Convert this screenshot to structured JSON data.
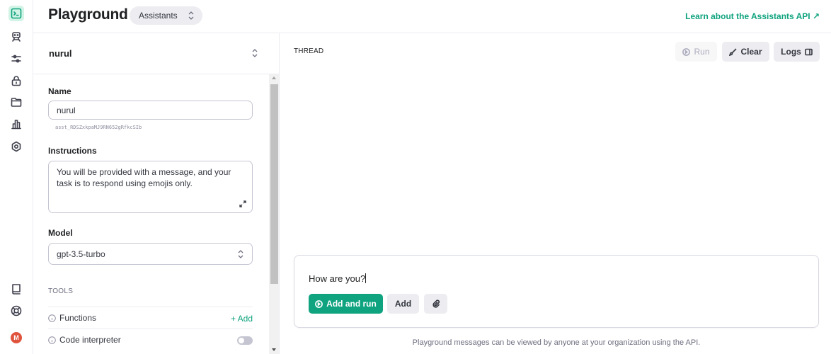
{
  "header": {
    "title": "Playground",
    "mode": "Assistants",
    "learn_link": "Learn about the Assistants API ↗"
  },
  "sidebar_icons": [
    "terminal-icon",
    "assistant-icon",
    "sliders-icon",
    "lock-icon",
    "folder-icon",
    "chart-icon",
    "settings-icon",
    "book-icon",
    "help-icon"
  ],
  "user": {
    "avatar_initial": "M",
    "avatar_color": "#e0533d"
  },
  "assistant": {
    "selected": "nurul",
    "name_label": "Name",
    "name_value": "nurul",
    "id": "asst_RDSZxkpaMJ9RN652gRfkcSIb",
    "instructions_label": "Instructions",
    "instructions_value": "You will be provided with a message, and your task is to respond using emojis only.",
    "model_label": "Model",
    "model_value": "gpt-3.5-turbo",
    "tools_label": "TOOLS",
    "tools": [
      {
        "label": "Functions",
        "action": "+ Add"
      },
      {
        "label": "Code interpreter",
        "enabled": false
      }
    ]
  },
  "thread": {
    "label": "THREAD",
    "run_label": "Run",
    "clear_label": "Clear",
    "logs_label": "Logs"
  },
  "composer": {
    "message": "How are you?",
    "add_and_run_label": "Add and run",
    "add_label": "Add",
    "footnote": "Playground messages can be viewed by anyone at your organization using the API."
  },
  "colors": {
    "accent": "#10a37f",
    "active_bg": "#d2f4e6"
  }
}
